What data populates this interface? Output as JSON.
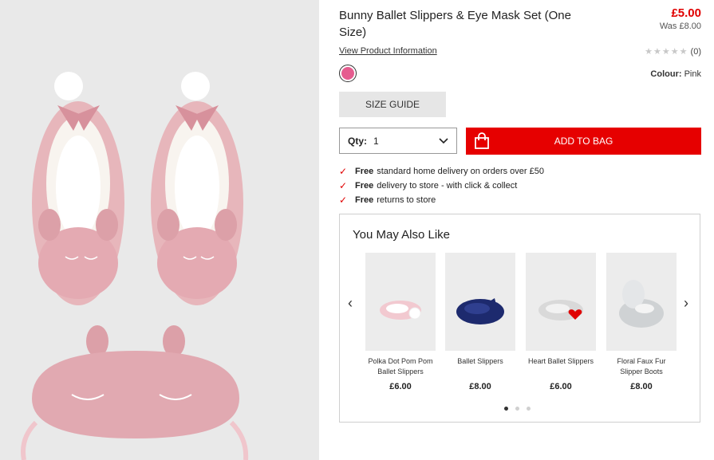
{
  "product": {
    "title": "Bunny Ballet Slippers & Eye Mask Set (One Size)",
    "price": "£5.00",
    "was_price": "Was £8.00",
    "info_link": "View Product Information",
    "rating_count": "(0)",
    "rating_stars": 0,
    "colour_label": "Colour:",
    "colour_value": "Pink",
    "swatch_color": "#e55c8f",
    "size_guide": "SIZE GUIDE",
    "qty_label": "Qty:",
    "qty_value": "1",
    "add_to_bag": "ADD TO BAG"
  },
  "delivery": [
    {
      "bold": "Free",
      "text": "standard home delivery on orders over £50"
    },
    {
      "bold": "Free",
      "text": "delivery to store - with click & collect"
    },
    {
      "bold": "Free",
      "text": "returns to store"
    }
  ],
  "recommendations": {
    "heading": "You May Also Like",
    "items": [
      {
        "name": "Polka Dot Pom Pom Ballet Slippers",
        "price": "£6.00"
      },
      {
        "name": "Ballet Slippers",
        "price": "£8.00"
      },
      {
        "name": "Heart Ballet Slippers",
        "price": "£6.00"
      },
      {
        "name": "Floral Faux Fur Slipper Boots",
        "price": "£8.00"
      }
    ],
    "active_page": 1,
    "page_count": 3
  },
  "colors": {
    "accent_red": "#e60000",
    "price_red": "#e00000"
  }
}
